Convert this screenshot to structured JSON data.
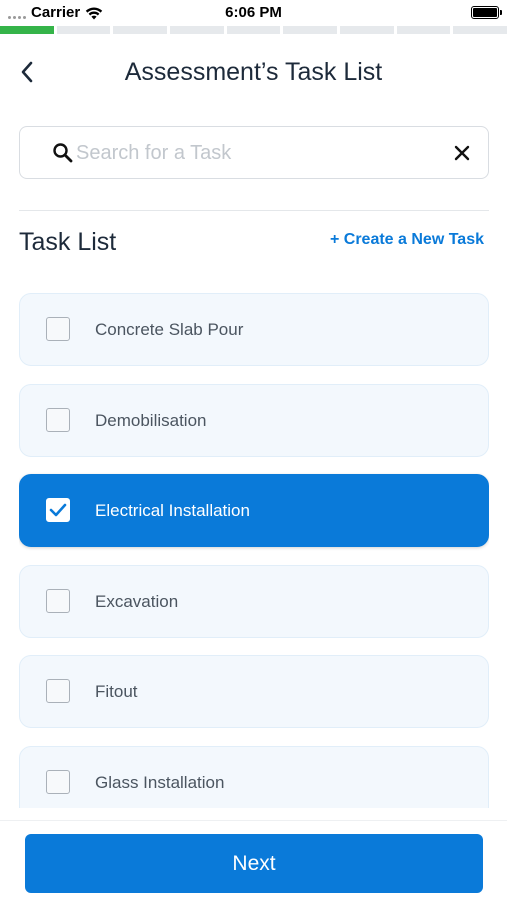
{
  "status_bar": {
    "carrier": "Carrier",
    "time": "6:06 PM",
    "icons": [
      "signal-icon",
      "wifi-icon",
      "battery-icon"
    ]
  },
  "progress": {
    "total_steps": 9,
    "completed_steps": 1,
    "done_color": "#35b449",
    "pending_color": "#e6e9ec"
  },
  "header": {
    "title": "Assessment’s Task List",
    "back_icon": "chevron-left-icon"
  },
  "search": {
    "value": "",
    "placeholder": "Search for a Task",
    "icon": "search-icon",
    "clear_icon": "close-icon"
  },
  "section": {
    "title": "Task List",
    "create_label": "+ Create a New Task"
  },
  "tasks": [
    {
      "label": "Concrete Slab Pour",
      "checked": false
    },
    {
      "label": "Demobilisation",
      "checked": false
    },
    {
      "label": "Electrical Installation",
      "checked": true
    },
    {
      "label": "Excavation",
      "checked": false
    },
    {
      "label": "Fitout",
      "checked": false
    },
    {
      "label": "Glass Installation",
      "checked": false
    }
  ],
  "footer": {
    "next_label": "Next"
  },
  "colors": {
    "accent": "#0a7ad9",
    "card_bg": "#f3f8fd",
    "text": "#1d2a3a"
  }
}
